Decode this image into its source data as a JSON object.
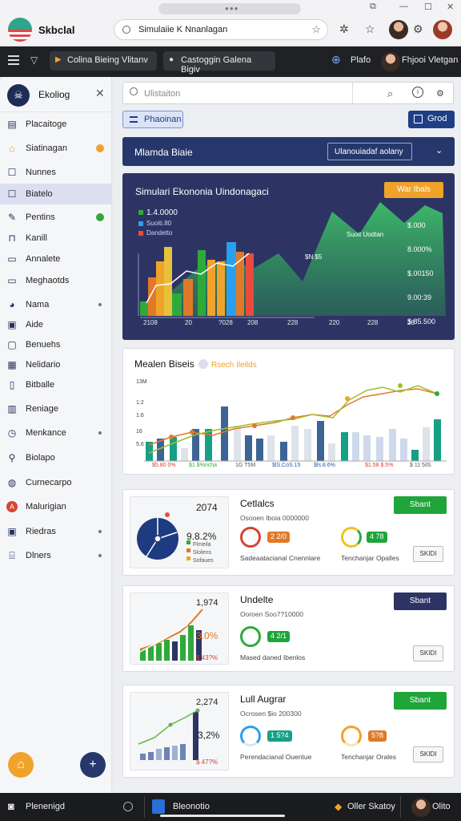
{
  "browser": {
    "brand": "Skbclal",
    "url": "Simulaiie K Nnanlagan"
  },
  "appbar": {
    "chip1": "Colina Bieing Vlitanv",
    "chip2": "Castoggin Galena Bigiv",
    "right1": "Plafo",
    "right2": "Fhjooi Vletgan"
  },
  "sidebar": {
    "title": "Ekoliog",
    "items": [
      {
        "label": "Placaitoge",
        "icon": "book-icon"
      },
      {
        "label": "Siatinagan",
        "icon": "home-icon",
        "badge": "#f0a32a"
      },
      {
        "label": "Nunnes",
        "icon": "square-icon"
      },
      {
        "label": "Biatelo",
        "icon": "square-icon",
        "selected": true
      },
      {
        "label": "Pentins",
        "icon": "pencil-icon",
        "badge": "#2faa3a"
      },
      {
        "label": "Kanill",
        "icon": "bar-icon"
      },
      {
        "label": "Annalete",
        "icon": "doc-icon"
      },
      {
        "label": "Meghaotds",
        "icon": "doc-icon"
      },
      {
        "label": "Nama",
        "icon": "palette-icon",
        "dot": true
      },
      {
        "label": "Aide",
        "icon": "image-icon"
      },
      {
        "label": "Benuehs",
        "icon": "window-icon"
      },
      {
        "label": "Nelidario",
        "icon": "calendar-icon"
      },
      {
        "label": "Bitballe",
        "icon": "file-icon"
      },
      {
        "label": "Reniage",
        "icon": "grid-icon"
      },
      {
        "label": "Menkance",
        "icon": "clock-icon",
        "dot": true
      },
      {
        "label": "Biolapo",
        "icon": "flask-icon"
      },
      {
        "label": "Curnecarpo",
        "icon": "globe-icon"
      },
      {
        "label": "Malurigian",
        "icon": "a-icon"
      },
      {
        "label": "Riedras",
        "icon": "monitor-icon",
        "dot": true
      },
      {
        "label": "Dlners",
        "icon": "building-icon",
        "dot": true
      }
    ]
  },
  "main": {
    "search_placeholder": "Ulistaiton",
    "filter_button": "Phaoinan",
    "grid_button": "Grod",
    "banner_title": "Mlamda Biaie",
    "banner_select": "Ulanouiadaf aolany",
    "hero": {
      "title": "Simulari Ekononia Uindonagaci",
      "button": "War Ibals",
      "legend": [
        "1.4.0000",
        "Suoiti.80",
        "Dandetto"
      ],
      "label_mid": "Suoit Uodtan",
      "label_mid2": "$N $5",
      "right_ticks": [
        "$.000",
        "8.000%",
        "$.00150",
        "9.00:39",
        "$ 85.500"
      ],
      "x_ticks": [
        "2108",
        "20",
        "?028",
        "208",
        "228",
        "220",
        "228",
        "28"
      ]
    },
    "section2": {
      "title": "Mealen Biseis",
      "tag": "Rsech Ileilds",
      "y_ticks": [
        "13M",
        "1:2",
        "1:6",
        "16",
        "5.6"
      ],
      "x_legend": [
        "$5.80 0%",
        "$1 $%ncha",
        "1G T5M",
        "$lS.CoS.15",
        "$ls.8.6%",
        "$1.58 $.5%",
        "$ 11 5ilS"
      ]
    },
    "cards": [
      {
        "thumb_value": "2074",
        "thumb_pct": "9.8.2%",
        "thumb_legend": [
          "Flmeila",
          "Slolens",
          "Sofaues"
        ],
        "title": "Cetlalcs",
        "sub": "Osooen Iboia 0000000",
        "badge1": "2 2/0",
        "badge2": "4 78",
        "cap1": "Sadeaatacianal Cnennlare",
        "cap2": "Tenchanjar Opalles",
        "button": "Sbant",
        "small": "SKIDI"
      },
      {
        "thumb_value": "1,974",
        "thumb_pct": "3.0%",
        "thumb_pct2": "$.43?%",
        "title": "Undelte",
        "sub": "Ooroen Soo7?10000",
        "badge1": "4 2/1",
        "cap1": "Mased daned Ibenlos",
        "button": "Sbant",
        "small": "SKIDI"
      },
      {
        "thumb_value": "2,274",
        "thumb_pct": "3,2%",
        "thumb_pct2": "$ 47?%",
        "title": "Lull Augrar",
        "sub": "Ocrosen $io 200300",
        "badge1": "1 5?4",
        "badge2": "5?8",
        "cap1": "Perendacianal Ouentue",
        "cap2": "Tenchanjar Orales",
        "button": "Sbant",
        "small": "SKIDI"
      }
    ]
  },
  "taskbar": {
    "item1": "Plenenigd",
    "item2": "Bleonotio",
    "item3": "Oller Skatoy",
    "item4": "Olito"
  },
  "colors": {
    "navy": "#26386b",
    "green": "#1fa53a",
    "orange": "#f0a32a",
    "teal": "#16a085",
    "blue_bar": "#3c6596"
  }
}
